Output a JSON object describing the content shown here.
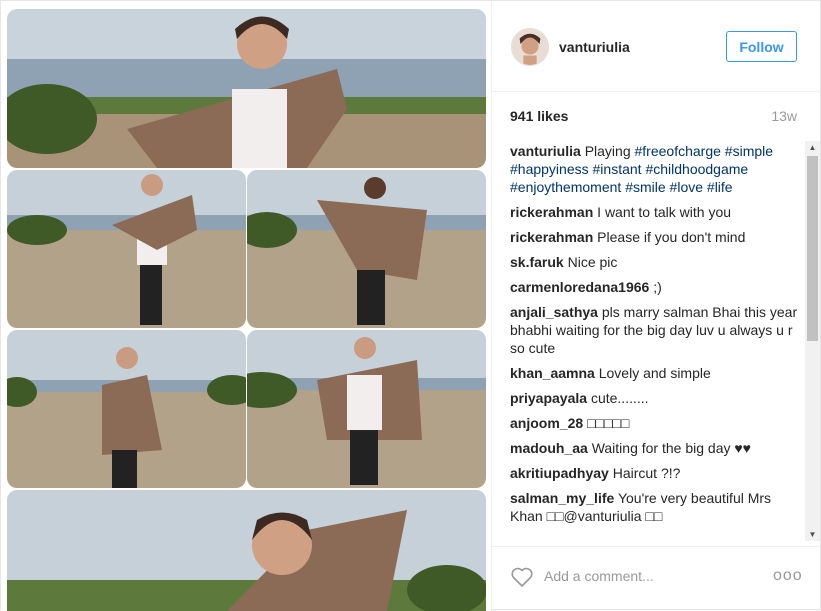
{
  "post": {
    "username": "vanturiulia",
    "follow_label": "Follow",
    "likes": "941 likes",
    "age": "13w",
    "add_comment_placeholder": "Add a comment...",
    "more_label": "ooo"
  },
  "caption": {
    "user": "vanturiulia",
    "text": "Playing",
    "tags": [
      "#freeofcharge",
      "#simple",
      "#happyiness",
      "#instant",
      "#childhoodgame",
      "#enjoythemoment",
      "#smile",
      "#love",
      "#life"
    ]
  },
  "comments": [
    {
      "user": "rickerahman",
      "text": "I want to talk with you"
    },
    {
      "user": "rickerahman",
      "text": "Please if you don't mind"
    },
    {
      "user": "sk.faruk",
      "text": "Nice pic"
    },
    {
      "user": "carmenloredana1966",
      "text": ";)"
    },
    {
      "user": "anjali_sathya",
      "text": "pls marry salman Bhai this year bhabhi waiting for the big day luv u always u r so cute"
    },
    {
      "user": "khan_aamna",
      "text": "Lovely and simple"
    },
    {
      "user": "priyapayala",
      "text": "cute........"
    },
    {
      "user": "anjoom_28",
      "text": "□□□□□"
    },
    {
      "user": "madouh_aa",
      "text": "Waiting for the big day ♥♥"
    },
    {
      "user": "akritiupadhyay",
      "text": "Haircut ?!?"
    },
    {
      "user": "salman_my_life",
      "text": "You're very beautiful Mrs Khan □□@vanturiulia □□"
    }
  ],
  "scrollbar": {
    "up": "▲",
    "down": "▼"
  },
  "colors": {
    "accent": "#3897f0",
    "hashtag": "#003569",
    "muted": "#999999",
    "text": "#262626"
  }
}
